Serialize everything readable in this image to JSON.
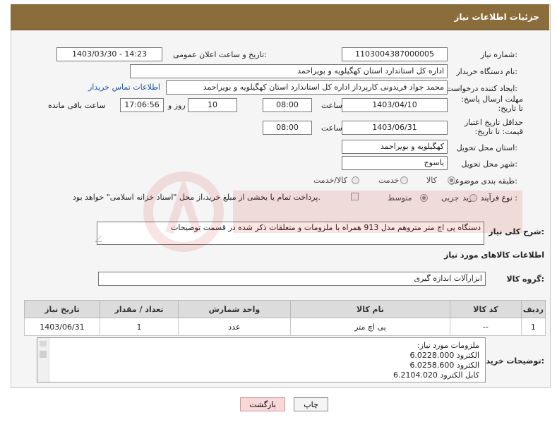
{
  "header": {
    "title": "جزئیات اطلاعات نیاز"
  },
  "fields": {
    "need_number_label": "شماره نیاز:",
    "need_number": "1103004387000005",
    "announce_label": "تاریخ و ساعت اعلان عمومی:",
    "announce_value": "1403/03/30 - 14:23",
    "buyer_label": "نام دستگاه خریدار:",
    "buyer_value": "اداره کل استاندارد استان کهگیلویه و بویراحمد",
    "creator_label": "ایجاد کننده درخواست:",
    "creator_value": "محمد جواد  فریدونی کارپرداز اداره کل استاندارد استان کهگیلویه و بویراحمد",
    "contact_link": "اطلاعات تماس خریدار",
    "reply_label": "مهلت ارسال پاسخ: تا تاریخ:",
    "reply_date": "1403/04/10",
    "time_label": "ساعت",
    "reply_time": "08:00",
    "days_value": "10",
    "days_label": "روز و",
    "remaining_time": "17:06:56",
    "remaining_label": "ساعت باقی مانده",
    "price_valid_label": "حداقل تاریخ اعتبار قیمت: تا تاریخ:",
    "price_valid_date": "1403/06/31",
    "price_valid_time": "08:00",
    "province_label": "استان محل تحویل:",
    "province_value": "کهگیلویه و بویراحمد",
    "city_label": "شهر محل تحویل:",
    "city_value": "یاسوج",
    "category_label": "طبقه بندی موضوعی:",
    "category_options": [
      "کالا",
      "خدمت",
      "کالا/خدمت"
    ],
    "process_label": "نوع فرآیند خرید :",
    "process_options": [
      "جزیی",
      "متوسط"
    ],
    "payment_note": "پرداخت تمام یا بخشی از مبلغ خرید،از محل \"اسناد خزانه اسلامی\" خواهد بود.",
    "description_label": "شرح کلی نیاز:",
    "description_value": "دستگاه پی اچ متر متروهم مدل 913 همراه با ملزومات و متعلقات ذکر شده در قسمت توضیحات",
    "items_section_title": "اطلاعات کالاهای مورد نیاز",
    "group_label": "گروه کالا:",
    "group_value": "ابزارآلات اندازه گیری"
  },
  "table": {
    "headers": [
      "ردیف",
      "کد کالا",
      "نام کالا",
      "واحد شمارش",
      "تعداد / مقدار",
      "تاریخ نیاز"
    ],
    "rows": [
      [
        "1",
        "--",
        "پی اچ متر",
        "عدد",
        "1",
        "1403/06/31"
      ]
    ]
  },
  "notes": {
    "label": "توضیحات خریدار:",
    "lines": [
      "ملزومات مورد نیاز:",
      "الکترود 6.0228.000",
      "الکترود 6.0258.600",
      "کابل الکترود  6.2104.020"
    ]
  },
  "buttons": {
    "print": "چاپ",
    "back": "بازگشت"
  },
  "colors": {
    "header_bg": "#8a6d3b",
    "link": "#1a4fa0"
  }
}
